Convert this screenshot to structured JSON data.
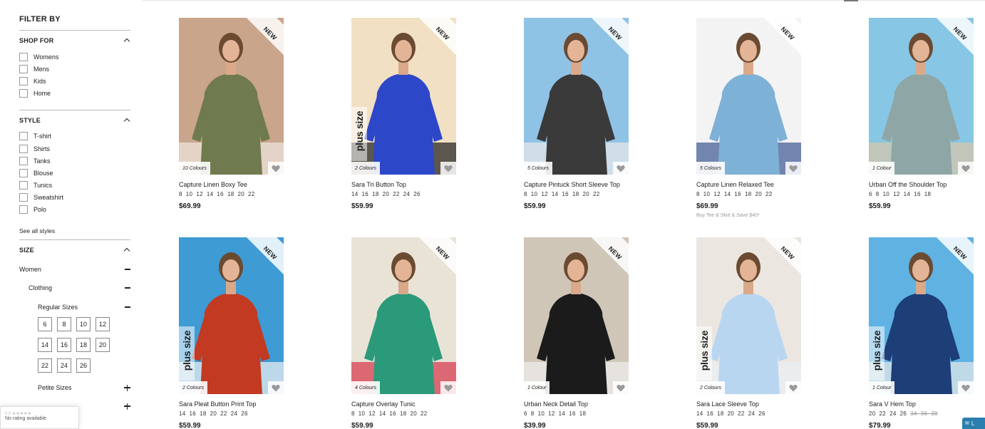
{
  "sidebar": {
    "title": "FILTER BY",
    "shop_for": {
      "label": "SHOP FOR",
      "options": [
        "Womens",
        "Mens",
        "Kids",
        "Home"
      ]
    },
    "style": {
      "label": "STYLE",
      "options": [
        "T-shirt",
        "Shirts",
        "Tanks",
        "Blouse",
        "Tunics",
        "Sweatshirt",
        "Polo"
      ],
      "see_all": "See all styles"
    },
    "size": {
      "label": "SIZE",
      "women": "Women",
      "clothing": "Clothing",
      "regular": "Regular Sizes",
      "regular_sizes": [
        "6",
        "8",
        "10",
        "12",
        "14",
        "16",
        "18",
        "20",
        "22",
        "24",
        "26"
      ],
      "petite": "Petite Sizes"
    }
  },
  "rating_widget": {
    "score": "0.0 ★★★★★",
    "text": "No rating available"
  },
  "badges": {
    "new": "NEW",
    "plus_size": "plus size"
  },
  "chat": {
    "label": "L"
  },
  "products": [
    {
      "name": "Capture Linen Boxy Tee",
      "sizes": "8  10  12  14  16  18  20  22",
      "price": "$69.99",
      "colours": "10 Colours",
      "plus": false,
      "promo": "",
      "colors": [
        "#c9a58c",
        "#6f7a4e",
        "#efe8df"
      ]
    },
    {
      "name": "Sara Tri Button Top",
      "sizes": "14  16  18  20  22  24  26",
      "price": "$59.99",
      "colours": "2 Colours",
      "plus": true,
      "promo": "",
      "colors": [
        "#f1e0c4",
        "#2d47c9",
        "#1c1c1c"
      ]
    },
    {
      "name": "Capture Pintuck Short Sleeve Top",
      "sizes": "8  10  12  14  16  18  20  22",
      "price": "$59.99",
      "colours": "5 Colours",
      "plus": false,
      "promo": "",
      "colors": [
        "#8fc3e6",
        "#3a3a3a",
        "#e9e9e9"
      ]
    },
    {
      "name": "Capture Linen Relaxed Tee",
      "sizes": "8  10  12  14  16  18  20  22",
      "price": "$69.99",
      "colours": "5 Colours",
      "plus": false,
      "promo": "Buy Tee & Skirt & Save $40*",
      "colors": [
        "#f3f3f3",
        "#7eb1d6",
        "#3b5590"
      ]
    },
    {
      "name": "Urban Off the Shoulder Top",
      "sizes": "6  8  10  12  14  16  18",
      "price": "$59.99",
      "colours": "1 Colour",
      "plus": false,
      "promo": "",
      "colors": [
        "#87c6e4",
        "#8fa6a7",
        "#d8c7a8"
      ]
    },
    {
      "name": "Sara Pleat Button Print Top",
      "sizes": "14  16  18  20  22  24  26",
      "price": "$59.99",
      "colours": "2 Colours",
      "plus": true,
      "promo": "",
      "colors": [
        "#3e9bd3",
        "#c23a22",
        "#f2f2f2"
      ]
    },
    {
      "name": "Capture Overlay Tunic",
      "sizes": "8  10  12  14  16  18  20  22",
      "price": "$59.99",
      "colours": "4 Colours",
      "plus": false,
      "promo": "",
      "colors": [
        "#e9e3d6",
        "#2a9a7a",
        "#d6334a"
      ]
    },
    {
      "name": "Urban Neck Detail Top",
      "sizes": "6  8  10  12  14  16  18",
      "price": "$39.99",
      "colours": "1 Colour",
      "plus": false,
      "promo": "",
      "colors": [
        "#cfc6b8",
        "#1b1b1b",
        "#efefef"
      ]
    },
    {
      "name": "Sara Lace Sleeve Top",
      "sizes": "14  16  18  20  22  24  26",
      "price": "$59.99",
      "colours": "2 Colours",
      "plus": true,
      "promo": "",
      "colors": [
        "#ece6e1",
        "#b9d6f1",
        "#e9eef3"
      ]
    },
    {
      "name": "Sara V Hem Top",
      "sizes": "20  22  24  26  34  36  38",
      "strike_from": 4,
      "price": "$79.99",
      "colours": "1 Colour",
      "plus": true,
      "promo": "",
      "colors": [
        "#5fb2e2",
        "#1d3e76",
        "#e9e9e9"
      ]
    }
  ]
}
